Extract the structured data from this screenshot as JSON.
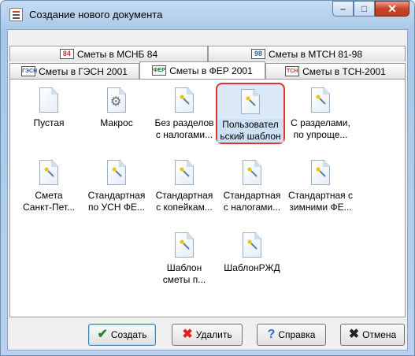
{
  "window": {
    "title": "Создание нового документа",
    "icon": "document-app-icon"
  },
  "controls": {
    "minimize": "–",
    "maximize": "□",
    "close": "✕"
  },
  "tabs": {
    "row1": [
      {
        "label": "Сметы в МСНБ 84",
        "badge": "84",
        "badge_color": "#c0392b"
      },
      {
        "label": "Сметы в МТСН 81-98",
        "badge": "98",
        "badge_color": "#2c5fa8"
      }
    ],
    "row2": [
      {
        "label": "Сметы в ГЭСН 2001",
        "badge": "ГЭСН",
        "badge_color": "#2c5fa8"
      },
      {
        "label": "Сметы в ФЕР 2001",
        "badge": "ФЕР",
        "badge_color": "#1a7a2a",
        "active": true
      },
      {
        "label": "Сметы в ТСН-2001",
        "badge": "ТСН",
        "badge_color": "#c0392b"
      }
    ]
  },
  "items": [
    {
      "label": "Пустая",
      "icon": "blank-document-icon"
    },
    {
      "label": "Макрос",
      "icon": "macro-gear-icon"
    },
    {
      "label": "Без разделов\nс налогами...",
      "icon": "template-wand-icon"
    },
    {
      "label": "Пользовател\nьский шаблон",
      "icon": "template-wand-icon",
      "selected": true
    },
    {
      "label": "С разделами,\nпо упроще...",
      "icon": "template-wand-icon"
    },
    {
      "label": "Смета\nСанкт-Пет...",
      "icon": "template-wand-icon"
    },
    {
      "label": "Стандартная\nпо УСН ФЕ...",
      "icon": "template-wand-icon"
    },
    {
      "label": "Стандартная\nс копейкам...",
      "icon": "template-wand-icon"
    },
    {
      "label": "Стандартная\nс налогами...",
      "icon": "template-wand-icon"
    },
    {
      "label": "Стандартная с\nзимними ФЕ...",
      "icon": "template-wand-icon"
    },
    {
      "label": "Шаблон\nсметы п...",
      "icon": "template-wand-icon"
    },
    {
      "label": "ШаблонРЖД",
      "icon": "template-wand-icon"
    }
  ],
  "buttons": {
    "create": {
      "label": "Создать",
      "icon": "✔",
      "color": "#1f8a2a"
    },
    "delete": {
      "label": "Удалить",
      "icon": "✖",
      "color": "#d22"
    },
    "help": {
      "label": "Справка",
      "icon": "?",
      "color": "#2a6fc0"
    },
    "cancel": {
      "label": "Отмена",
      "icon": "✖",
      "color": "#222"
    }
  }
}
